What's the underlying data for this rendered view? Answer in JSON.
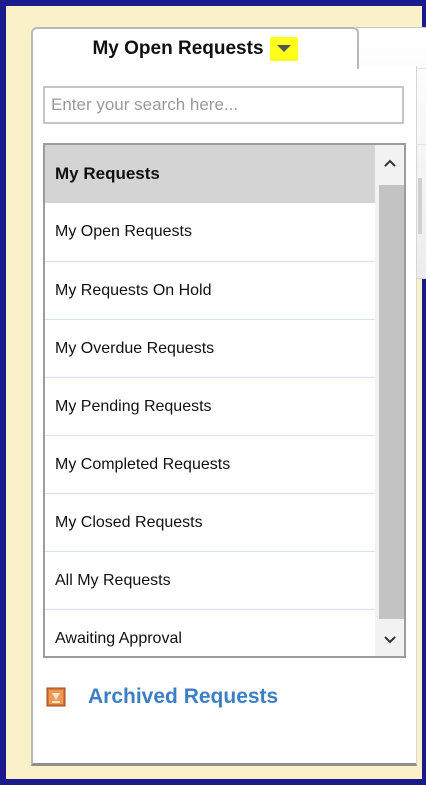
{
  "tab": {
    "title": "My Open Requests"
  },
  "search": {
    "placeholder": "Enter your search here..."
  },
  "list": {
    "header": "My Requests",
    "items": [
      "My Open Requests",
      "My Requests On Hold",
      "My Overdue Requests",
      "My Pending Requests",
      "My Completed Requests",
      "My Closed Requests",
      "All My Requests",
      "Awaiting Approval"
    ]
  },
  "archived": {
    "label": "Archived Requests",
    "icon": "archive-box-icon"
  },
  "colors": {
    "window_border": "#1a1a8c",
    "background": "#fbf1c8",
    "dropdown_highlight": "#ffff1a",
    "link": "#3d7fc4",
    "header_bg": "#d4d4d4"
  }
}
